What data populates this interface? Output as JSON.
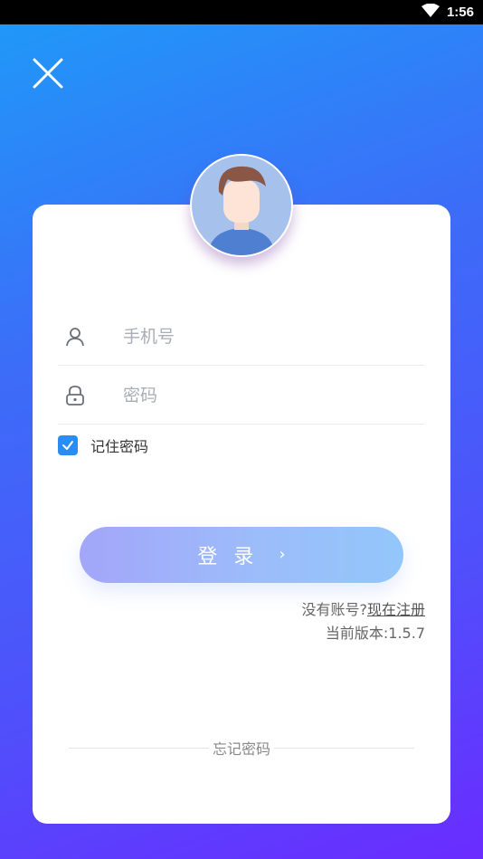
{
  "status_bar": {
    "time": "1:56"
  },
  "login": {
    "phone_placeholder": "手机号",
    "password_placeholder": "密码",
    "remember_label": "记住密码",
    "remember_checked": true,
    "login_button": "登录",
    "login_chevron": "›",
    "no_account_text": "没有账号?",
    "register_link": "现在注册",
    "version_text": "当前版本:1.5.7",
    "forgot_password": "忘记密码"
  },
  "colors": {
    "background_gradient": [
      "#1e9bf8",
      "#4f50fb",
      "#6a2cff"
    ],
    "checkbox": "#2a8cf5",
    "login_button_gradient": [
      "#a3a6f9",
      "#93c6fb"
    ]
  },
  "icons": {
    "close": "close-icon",
    "user": "user-icon",
    "lock": "lock-icon",
    "check": "check-icon",
    "wifi": "wifi-icon"
  }
}
